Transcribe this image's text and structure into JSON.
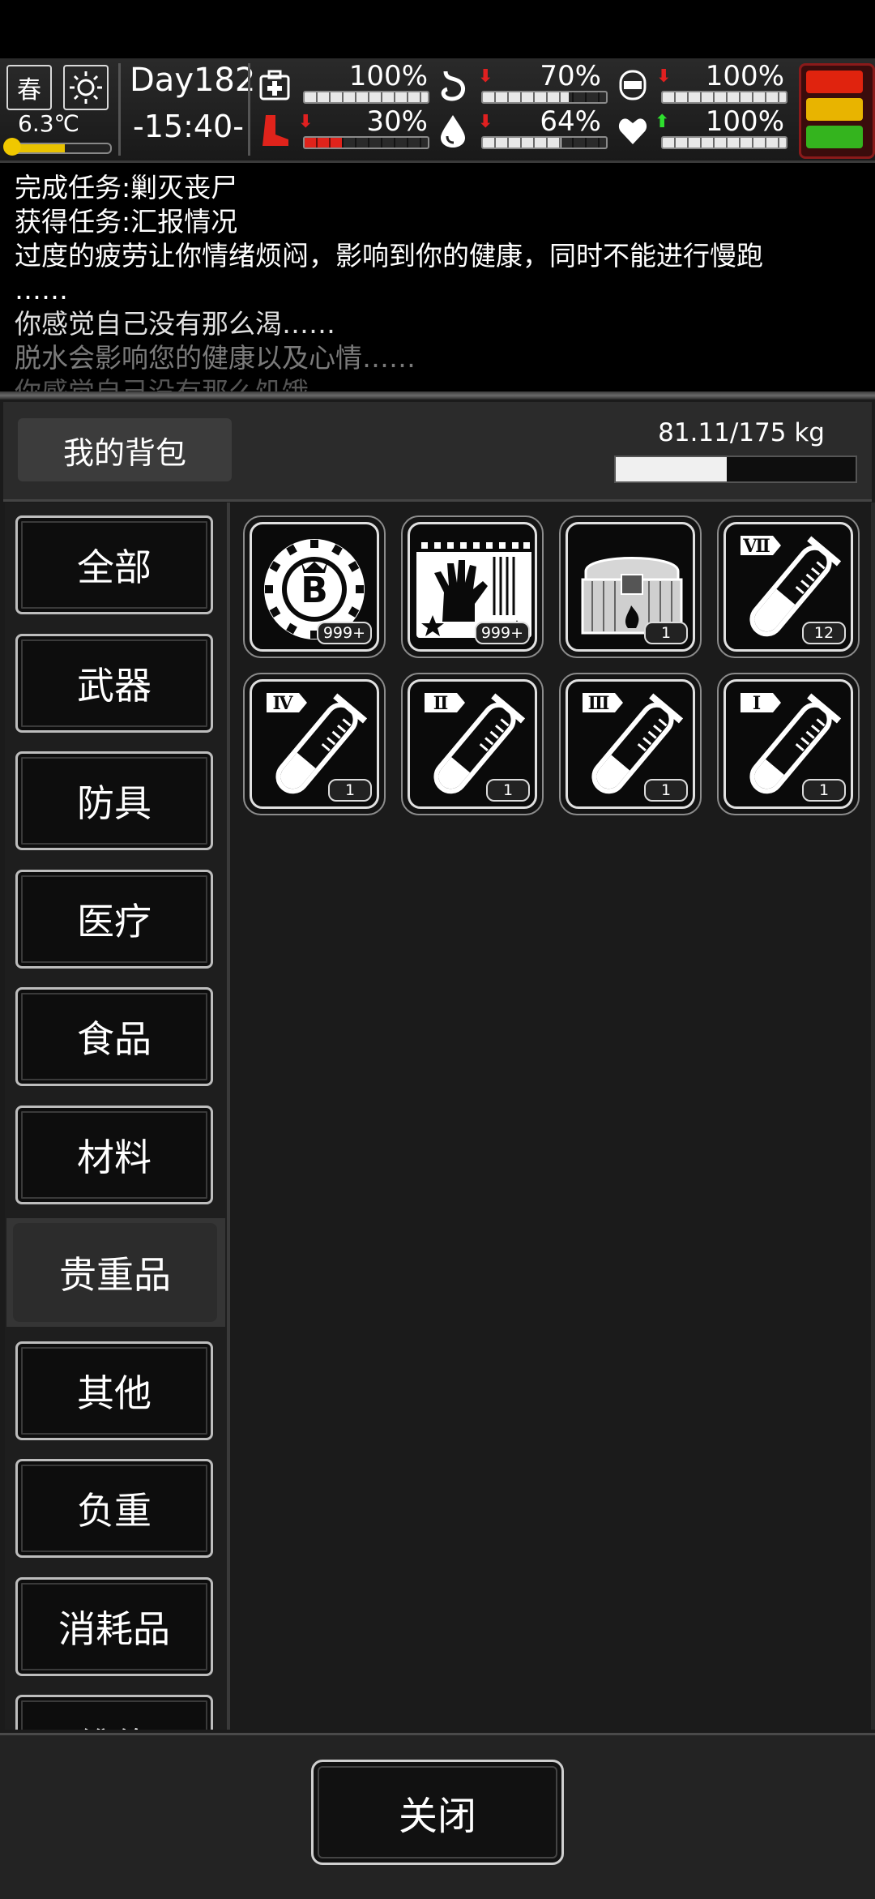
{
  "status": {
    "season": "春",
    "temperature": "6.3℃",
    "temperature_level": 0.55,
    "day": "Day182",
    "time": "-15:40-",
    "stats": [
      {
        "name": "health-icon",
        "value": "100%",
        "level": 1.0,
        "trend": "none"
      },
      {
        "name": "stomach-icon",
        "value": "70%",
        "level": 0.7,
        "trend": "down"
      },
      {
        "name": "shield-icon",
        "value": "100%",
        "level": 1.0,
        "trend": "down"
      },
      {
        "name": "boot-icon",
        "value": "30%",
        "level": 0.3,
        "trend": "down"
      },
      {
        "name": "water-drop-icon",
        "value": "64%",
        "level": 0.64,
        "trend": "down"
      },
      {
        "name": "heart-icon",
        "value": "100%",
        "level": 1.0,
        "trend": "up"
      }
    ],
    "alert_colors": [
      "#e0230e",
      "#e8b400",
      "#34b41e"
    ]
  },
  "log": [
    "完成任务:剿灭丧尸",
    "获得任务:汇报情况",
    "过度的疲劳让你情绪烦闷，影响到你的健康，同时不能进行慢跑",
    "……",
    "你感觉自己没有那么渴……",
    "脱水会影响您的健康以及心情……",
    "你感觉自己没有那么饥饿"
  ],
  "backpack": {
    "title": "我的背包",
    "weight": "81.11/175 kg",
    "weight_fraction": 0.4635
  },
  "categories": [
    {
      "label": "全部",
      "selected": false
    },
    {
      "label": "武器",
      "selected": false
    },
    {
      "label": "防具",
      "selected": false
    },
    {
      "label": "医疗",
      "selected": false
    },
    {
      "label": "食品",
      "selected": false
    },
    {
      "label": "材料",
      "selected": false
    },
    {
      "label": "贵重品",
      "selected": true
    },
    {
      "label": "其他",
      "selected": false
    },
    {
      "label": "负重",
      "selected": false
    },
    {
      "label": "消耗品",
      "selected": false
    },
    {
      "label": "维修",
      "selected": false
    }
  ],
  "items": [
    {
      "icon": "bitcoin-chip-icon",
      "count": "999+"
    },
    {
      "icon": "zombie-ticket-icon",
      "count": "999+"
    },
    {
      "icon": "treasure-chest-icon",
      "count": "1"
    },
    {
      "icon": "test-tube-icon",
      "tier": "Ⅶ",
      "count": "12",
      "fill": 0.55
    },
    {
      "icon": "test-tube-icon",
      "tier": "Ⅳ",
      "count": "1",
      "fill": 0.4
    },
    {
      "icon": "test-tube-icon",
      "tier": "Ⅱ",
      "count": "1",
      "fill": 0.3
    },
    {
      "icon": "test-tube-icon",
      "tier": "Ⅲ",
      "count": "1",
      "fill": 0.35
    },
    {
      "icon": "test-tube-icon",
      "tier": "Ⅰ",
      "count": "1",
      "fill": 0.25
    }
  ],
  "footer": {
    "close_label": "关闭"
  }
}
